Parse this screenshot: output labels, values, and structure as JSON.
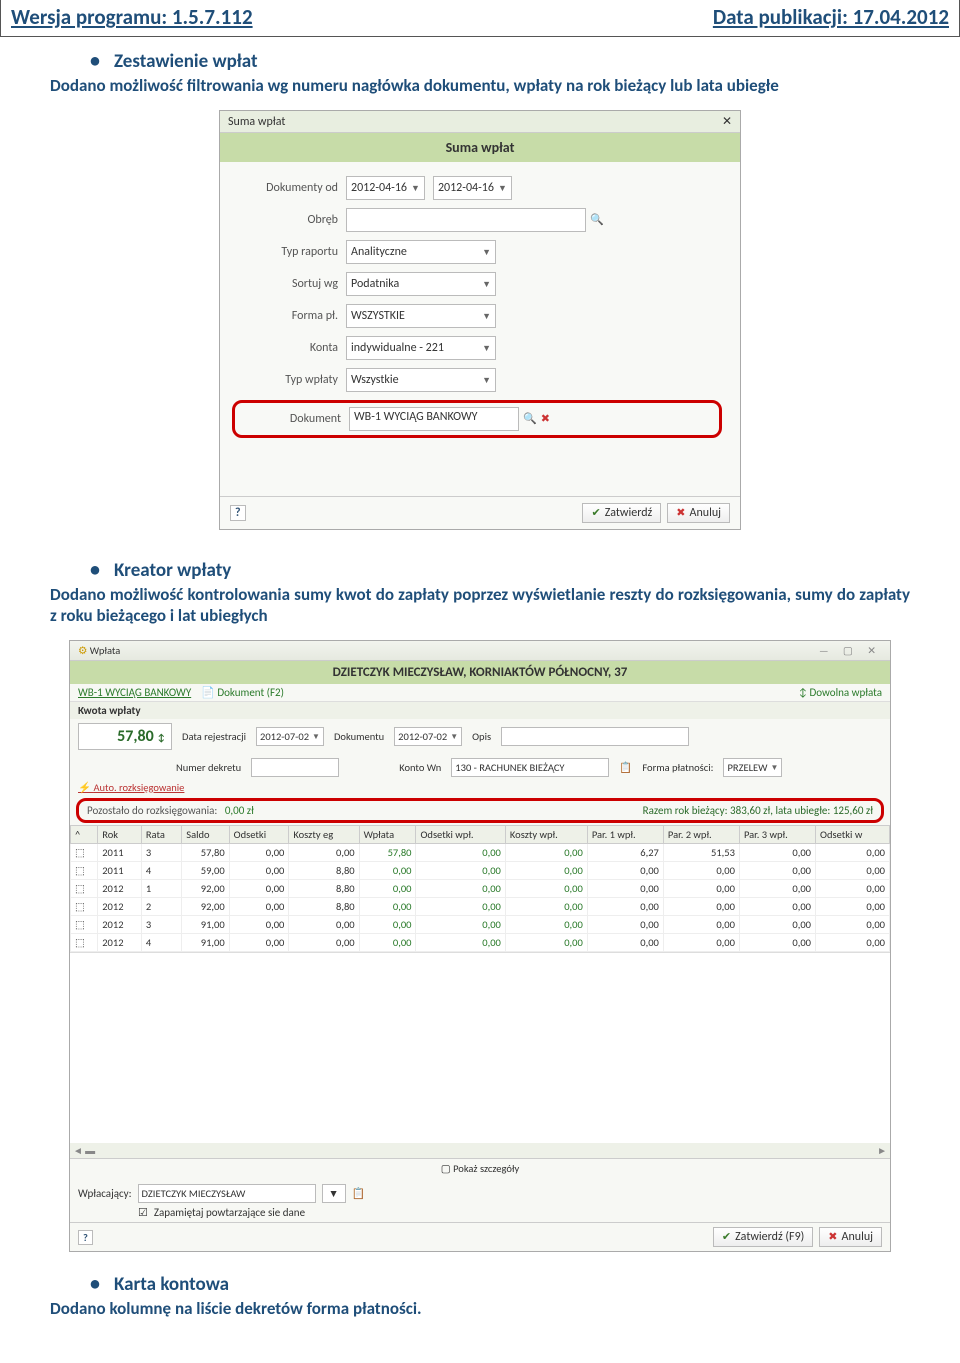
{
  "top": {
    "version_label": "Wersja programu: 1.5.7.112",
    "date_label": "Data publikacji: 17.04.2012"
  },
  "section1": {
    "title": "Zestawienie wpłat",
    "desc": "Dodano możliwość filtrowania wg numeru nagłówka dokumentu, wpłaty na rok bieżący lub lata ubiegłe"
  },
  "shot1": {
    "win_title": "Suma wpłat",
    "close_x": "✕",
    "header": "Suma wpłat",
    "labels": {
      "dokumenty_od": "Dokumenty od",
      "obreb": "Obręb",
      "typ_raportu": "Typ raportu",
      "sortuj_wg": "Sortuj wg",
      "forma_pl": "Forma pł.",
      "konta": "Konta",
      "typ_wplaty": "Typ wpłaty",
      "dokument": "Dokument"
    },
    "values": {
      "date_from": "2012-04-16",
      "date_to": "2012-04-16",
      "typ_raportu": "Analityczne",
      "sortuj_wg": "Podatnika",
      "forma_pl": "WSZYSTKIE",
      "konta": "indywidualne - 221",
      "typ_wplaty": "Wszystkie",
      "dokument": "WB-1 WYCIĄG BANKOWY"
    },
    "buttons": {
      "zatwierdz": "Zatwierdź",
      "anuluj": "Anuluj"
    }
  },
  "section2": {
    "title": "Kreator wpłaty",
    "desc": "Dodano możliwość kontrolowania sumy kwot do zapłaty poprzez wyświetlanie reszty do rozksięgowania, sumy do zapłaty z roku bieżącego i lat ubiegłych"
  },
  "shot2": {
    "win_title": "Wpłata",
    "header": "DZIETCZYK MIECZYSŁAW, KORNIAKTÓW PÓŁNOCNY,  37",
    "toolbar_left": "WB-1 WYCIĄG BANKOWY",
    "toolbar_doc": "Dokument (F2)",
    "toolbar_right": "Dowolna wpłata",
    "section_label": "Kwota wpłaty",
    "kwota": "57,80",
    "labels": {
      "data_rej": "Data rejestracji",
      "dokumentu": "Dokumentu",
      "opis": "Opis",
      "numer_dekretu": "Numer dekretu",
      "konto_wn": "Konto Wn",
      "forma_pl": "Forma płatności:"
    },
    "values": {
      "data_rej": "2012-07-02",
      "dokumentu": "2012-07-02",
      "konto_wn": "130 - RACHUNEK BIEŻĄCY",
      "forma_pl": "PRZELEW"
    },
    "auto_link": "Auto. rozksięgowanie",
    "redbox_left_label": "Pozostało do rozksięgowania:",
    "redbox_left_val": "0,00 zł",
    "redbox_right": "Razem rok bieżący: 383,60 zł,  lata ubiegłe: 125,60 zł",
    "columns": [
      "^",
      "Rok",
      "Rata",
      "Saldo",
      "Odsetki",
      "Koszty eg",
      "Wpłata",
      "Odsetki wpł.",
      "Koszty wpł.",
      "Par. 1 wpł.",
      "Par. 2 wpł.",
      "Par. 3 wpł.",
      "Odsetki w"
    ],
    "rows": [
      [
        "2011",
        "3",
        "57,80",
        "0,00",
        "0,00",
        "57,80",
        "0,00",
        "0,00",
        "6,27",
        "51,53",
        "0,00",
        "0,00"
      ],
      [
        "2011",
        "4",
        "59,00",
        "0,00",
        "8,80",
        "0,00",
        "0,00",
        "0,00",
        "0,00",
        "0,00",
        "0,00",
        "0,00"
      ],
      [
        "2012",
        "1",
        "92,00",
        "0,00",
        "8,80",
        "0,00",
        "0,00",
        "0,00",
        "0,00",
        "0,00",
        "0,00",
        "0,00"
      ],
      [
        "2012",
        "2",
        "92,00",
        "0,00",
        "8,80",
        "0,00",
        "0,00",
        "0,00",
        "0,00",
        "0,00",
        "0,00",
        "0,00"
      ],
      [
        "2012",
        "3",
        "91,00",
        "0,00",
        "0,00",
        "0,00",
        "0,00",
        "0,00",
        "0,00",
        "0,00",
        "0,00",
        "0,00"
      ],
      [
        "2012",
        "4",
        "91,00",
        "0,00",
        "0,00",
        "0,00",
        "0,00",
        "0,00",
        "0,00",
        "0,00",
        "0,00",
        "0,00"
      ]
    ],
    "show_details": "Pokaż szczegóły",
    "wplacajacy_lbl": "Wpłacający:",
    "wplacajacy_val": "DZIETCZYK MIECZYSŁAW",
    "remember": "Zapamiętaj powtarzające sie dane",
    "btn_zatw": "Zatwierdź (F9)",
    "btn_anul": "Anuluj"
  },
  "section3": {
    "title": "Karta kontowa",
    "desc": "Dodano kolumnę na liście dekretów forma płatności."
  }
}
